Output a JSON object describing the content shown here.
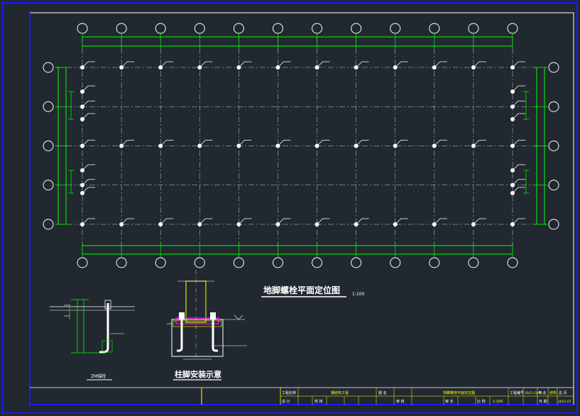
{
  "drawing": {
    "title": "地脚螺栓平面定位图",
    "scale": "1:100",
    "column_grid_count": 12,
    "row_grid_count": 5
  },
  "details": {
    "bolt_detail_label": "ZM锚栓",
    "column_foot_label": "柱脚安装示意"
  },
  "title_block": {
    "project_label": "工程名称",
    "project_value": "钢结构工程",
    "drawing_name_label": "图 名",
    "drawing_name_value": "地脚螺栓平面定位图",
    "drawing_no_label": "工程编号",
    "drawing_no_value": "2021-GJ-01",
    "sheet_label": "专 业",
    "sheet_value": "结构",
    "page_label": "总 页",
    "page_value": "1",
    "design_label": "设 计",
    "check_label": "校 核",
    "review_label": "审 核",
    "approve_label": "审 定",
    "scale_label": "比 例",
    "scale_value": "1:100",
    "date_label": "日 期",
    "date_value": "2021.07"
  },
  "colors": {
    "background": "#212830",
    "frame": "#1a1aff",
    "line": "#ffffff",
    "grid_line": "#c8c8c8",
    "dimension": "#00ff00",
    "yellow": "#ffff00",
    "magenta": "#ff00ff"
  }
}
